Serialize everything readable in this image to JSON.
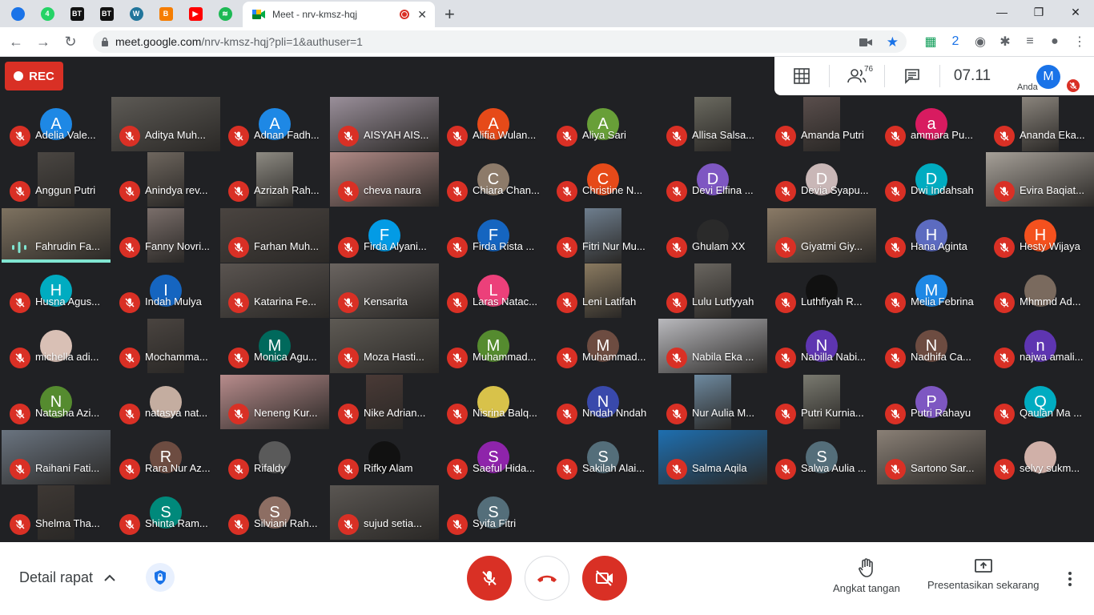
{
  "browser": {
    "pinned_tabs": [
      {
        "name": "ministry-logo-tab",
        "glyph": "",
        "color": "#1a73e8"
      },
      {
        "name": "whatsapp-tab",
        "glyph": "4",
        "color": "#25d366"
      },
      {
        "name": "bt-tab-1",
        "glyph": "BT",
        "color": "#111111"
      },
      {
        "name": "bt-tab-2",
        "glyph": "BT",
        "color": "#111111"
      },
      {
        "name": "wordpress-tab",
        "glyph": "W",
        "color": "#21759b"
      },
      {
        "name": "blogger-tab",
        "glyph": "B",
        "color": "#f57d00"
      },
      {
        "name": "youtube-tab",
        "glyph": "▶",
        "color": "#ff0000"
      },
      {
        "name": "spotify-tab",
        "glyph": "≋",
        "color": "#1db954"
      }
    ],
    "active_tab_title": "Meet - nrv-kmsz-hqj",
    "new_tab_symbol": "+",
    "url_host": "meet.google.com",
    "url_path": "/nrv-kmsz-hqj?pli=1&authuser=1",
    "window_controls": [
      "—",
      "❐",
      "✕"
    ],
    "extensions": [
      {
        "name": "sheets-extension-icon",
        "glyph": "▦",
        "color": "#0f9d58"
      },
      {
        "name": "docs-extension-icon",
        "glyph": "2",
        "color": "#1a73e8"
      },
      {
        "name": "chat-extension-icon",
        "glyph": "◉",
        "color": "#5f6368"
      },
      {
        "name": "puzzle-extension-icon",
        "glyph": "✱",
        "color": "#5f6368"
      },
      {
        "name": "media-control-icon",
        "glyph": "≡",
        "color": "#5f6368"
      },
      {
        "name": "profile-icon",
        "glyph": "●",
        "color": "#5f6368"
      },
      {
        "name": "chrome-menu-icon",
        "glyph": "⋮",
        "color": "#5f6368"
      }
    ]
  },
  "meeting": {
    "rec_label": "REC",
    "participants_count": "76",
    "clock": "07.11",
    "you_label": "Anda",
    "you_initial": "M",
    "details_label": "Detail rapat",
    "raise_hand_label": "Angkat tangan",
    "present_label": "Presentasikan sekarang"
  },
  "participants": [
    {
      "name": "Adelia Vale...",
      "initial": "A",
      "color": "#1e88e5"
    },
    {
      "name": "Aditya Muh...",
      "photo": "#5d5a55"
    },
    {
      "name": "Adnan Fadh...",
      "initial": "A",
      "color": "#1e88e5"
    },
    {
      "name": "AISYAH AIS...",
      "photo": "#9a8f9a"
    },
    {
      "name": "Alifia Wulan...",
      "initial": "A",
      "color": "#e64a19"
    },
    {
      "name": "Aliya Sari",
      "initial": "A",
      "color": "#689f38"
    },
    {
      "name": "Allisa Salsa...",
      "photo": "#6b6a60",
      "narrow": true
    },
    {
      "name": "Amanda Putri",
      "photo": "#5a4e4c",
      "narrow": true
    },
    {
      "name": "ammara Pu...",
      "initial": "a",
      "color": "#d81b60"
    },
    {
      "name": "Ananda Eka...",
      "photo": "#8a847c",
      "narrow": true
    },
    {
      "name": "Anggun Putri",
      "photo": "#4a4642",
      "narrow": true
    },
    {
      "name": "Anindya rev...",
      "photo": "#6e665e",
      "narrow": true
    },
    {
      "name": "Azrizah Rah...",
      "photo": "#8d8a82",
      "narrow": true
    },
    {
      "name": "cheva naura",
      "photo": "#b08a86"
    },
    {
      "name": "Chiara Chan...",
      "initial": "C",
      "color": "#8d7b6a"
    },
    {
      "name": "Christine N...",
      "initial": "C",
      "color": "#e64a19"
    },
    {
      "name": "Devi Elfina ...",
      "initial": "D",
      "color": "#7e57c2"
    },
    {
      "name": "Devia Syapu...",
      "initial": "D",
      "color": "#c9b7b7"
    },
    {
      "name": "Dwi Indahsah",
      "initial": "D",
      "color": "#00acc1"
    },
    {
      "name": "Evira Baqiat...",
      "photo": "#a6a098"
    },
    {
      "name": "Fahrudin Fa...",
      "photo": "#7e7260",
      "speaking": true
    },
    {
      "name": "Fanny Novri...",
      "photo": "#7a6e6a",
      "narrow": true
    },
    {
      "name": "Farhan Muh...",
      "photo": "#4a4440"
    },
    {
      "name": "Firda Alyani...",
      "initial": "F",
      "color": "#039be5"
    },
    {
      "name": "Firda Rista ...",
      "initial": "F",
      "color": "#1565c0"
    },
    {
      "name": "Fitri Nur Mu...",
      "photo": "#6e7e8e",
      "narrow": true
    },
    {
      "name": "Ghulam XX",
      "initial": "",
      "color": "#2a2a2a"
    },
    {
      "name": "Giyatmi Giy...",
      "photo": "#8a7a66"
    },
    {
      "name": "Hana Aginta",
      "initial": "H",
      "color": "#5c6bc0"
    },
    {
      "name": "Hesty Wijaya",
      "initial": "H",
      "color": "#f4511e"
    },
    {
      "name": "Husna Agus...",
      "initial": "H",
      "color": "#00acc1"
    },
    {
      "name": "Indah Mulya",
      "initial": "I",
      "color": "#1565c0"
    },
    {
      "name": "Katarina Fe...",
      "photo": "#5a5450"
    },
    {
      "name": "Kensarita",
      "photo": "#6a6460"
    },
    {
      "name": "Laras Natac...",
      "initial": "L",
      "color": "#ec407a"
    },
    {
      "name": "Leni Latifah",
      "photo": "#8a7a60",
      "narrow": true
    },
    {
      "name": "Lulu Lutfyyah",
      "photo": "#6a6660",
      "narrow": true
    },
    {
      "name": "Luthfiyah R...",
      "initial": "",
      "color": "#111111"
    },
    {
      "name": "Melia Febrina",
      "initial": "M",
      "color": "#1e88e5"
    },
    {
      "name": "Mhmmd Ad...",
      "initial": "",
      "color": "#7a6a5e"
    },
    {
      "name": "michella adi...",
      "initial": "",
      "color": "#d9c0b5"
    },
    {
      "name": "Mochamma...",
      "photo": "#4a4440",
      "narrow": true
    },
    {
      "name": "Monica Agu...",
      "initial": "M",
      "color": "#00695c"
    },
    {
      "name": "Moza Hasti...",
      "photo": "#5e5a54"
    },
    {
      "name": "Muhammad...",
      "initial": "M",
      "color": "#558b2f"
    },
    {
      "name": "Muhammad...",
      "initial": "M",
      "color": "#6d4c41"
    },
    {
      "name": "Nabila Eka ...",
      "photo": "#b9b9bd"
    },
    {
      "name": "Nabilla Nabi...",
      "initial": "N",
      "color": "#5e35b1"
    },
    {
      "name": "Nadhifa Ca...",
      "initial": "N",
      "color": "#6d4c41"
    },
    {
      "name": "najwa amali...",
      "initial": "n",
      "color": "#5e35b1"
    },
    {
      "name": "Natasha Azi...",
      "initial": "N",
      "color": "#558b2f"
    },
    {
      "name": "natasya nat...",
      "initial": "",
      "color": "#c4ada0"
    },
    {
      "name": "Neneng Kur...",
      "photo": "#b88c8c"
    },
    {
      "name": "Nike Adrian...",
      "photo": "#4a3a36",
      "narrow": true
    },
    {
      "name": "Nisrina Balq...",
      "initial": "",
      "color": "#d8c24a"
    },
    {
      "name": "Nndah Nndah",
      "initial": "N",
      "color": "#3949ab"
    },
    {
      "name": "Nur Aulia M...",
      "photo": "#6e8aa0",
      "narrow": true
    },
    {
      "name": "Putri Kurnia...",
      "photo": "#7a7a70",
      "narrow": true
    },
    {
      "name": "Putri Rahayu",
      "initial": "P",
      "color": "#7e57c2"
    },
    {
      "name": "Qaulan Ma ...",
      "initial": "Q",
      "color": "#00acc1"
    },
    {
      "name": "Raihani Fati...",
      "photo": "#6a7480"
    },
    {
      "name": "Rara Nur Az...",
      "initial": "R",
      "color": "#6d4c41"
    },
    {
      "name": "Rifaldy",
      "initial": "",
      "color": "#5a5a5a"
    },
    {
      "name": "Rifky Alam",
      "initial": "",
      "color": "#111111"
    },
    {
      "name": "Saeful Hida...",
      "initial": "S",
      "color": "#8e24aa"
    },
    {
      "name": "Sakilah Alai...",
      "initial": "S",
      "color": "#546e7a"
    },
    {
      "name": "Salma Aqila",
      "photo": "#1e6fb0"
    },
    {
      "name": "Salwa Aulia ...",
      "initial": "S",
      "color": "#546e7a"
    },
    {
      "name": "Sartono Sar...",
      "photo": "#8a8076"
    },
    {
      "name": "selvy sukm...",
      "initial": "",
      "color": "#d0b0a8"
    },
    {
      "name": "Shelma Tha...",
      "photo": "#3e3834",
      "narrow": true
    },
    {
      "name": "Shinta Ram...",
      "initial": "S",
      "color": "#00897b"
    },
    {
      "name": "Silviani Rah...",
      "initial": "S",
      "color": "#8d6e63"
    },
    {
      "name": "sujud setia...",
      "photo": "#5a5652"
    },
    {
      "name": "Syifa Fitri",
      "initial": "S",
      "color": "#546e7a"
    }
  ]
}
